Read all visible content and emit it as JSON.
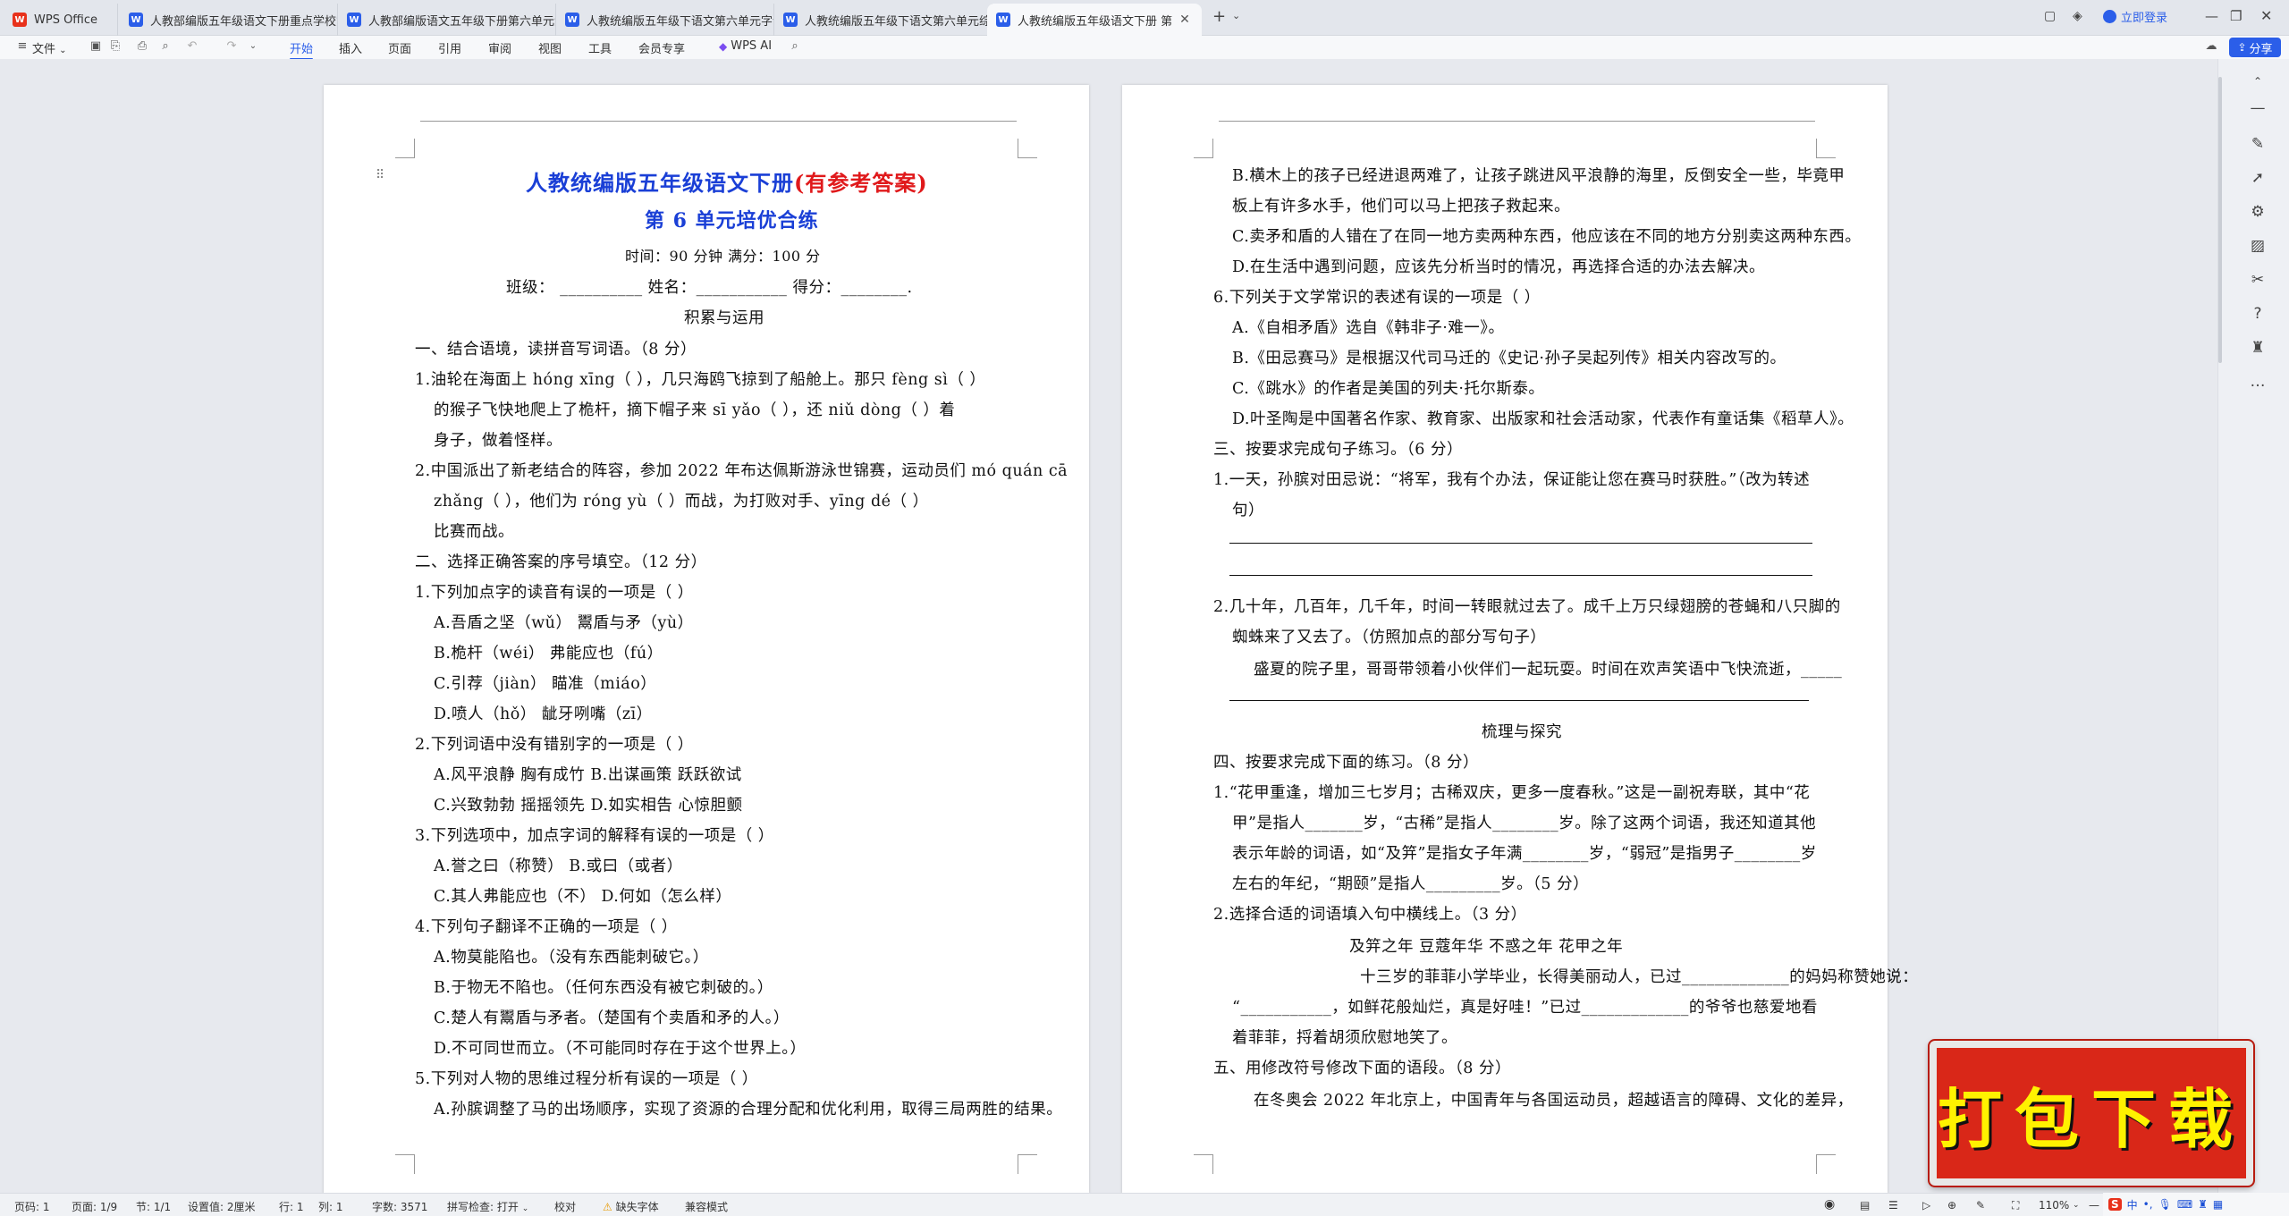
{
  "app": {
    "name": "WPS Office",
    "login": "立即登录"
  },
  "tabs": [
    {
      "label": "人教部编版五年级语文下册重点学校第"
    },
    {
      "label": "人教部编版语文五年级下册第六单元测"
    },
    {
      "label": "人教统编版五年级下语文第六单元字词"
    },
    {
      "label": "人教统编版五年级下语文第六单元综合"
    },
    {
      "label": "人教统编版五年级语文下册 第"
    }
  ],
  "menu": {
    "file": "文件",
    "items": [
      "开始",
      "插入",
      "页面",
      "引用",
      "审阅",
      "视图",
      "工具",
      "会员专享"
    ],
    "ai": "WPS AI",
    "share": "分享"
  },
  "page1": {
    "title_blue": "人教统编版五年级语文下册",
    "title_red": "(有参考答案)",
    "subtitle": "第 6 单元培优合练",
    "time": "时间：90 分钟  满分：100 分",
    "student": "班级：  __________  姓名：___________  得分：________.",
    "section_head": "积累与运用",
    "lines": [
      "一、结合语境，读拼音写词语。（8 分）",
      "1.油轮在海面上 hóng xīng（      ），几只海鸥飞掠到了船舱上。那只 fèng sì（      ）",
      "的猴子飞快地爬上了桅杆，摘下帽子来 sī yǎo（      ），还 niǔ dòng（      ）着",
      "身子，做着怪样。",
      "2.中国派出了新老结合的阵容，参加 2022 年布达佩斯游泳世锦赛，运动员们 mó quán cā",
      "zhǎng（        ），他们为 róng yù（       ）而战，为打败对手、yīng dé（      ）",
      "比赛而战。",
      "二、选择正确答案的序号填空。（12 分）",
      "1.下列加点字的读音有误的一项是（    ）",
      "A.吾盾之坚（wǔ）             鬻盾与矛（yù）",
      "B.桅杆（wéi）                弗能应也（fú）",
      "C.引荐（jiàn）               瞄准（miáo）",
      "D.喷人（hǒ）                 龇牙咧嘴（zī）",
      "2.下列词语中没有错别字的一项是（    ）",
      "A.风平浪静      胸有成竹       B.出谋画策       跃跃欲试",
      "C.兴致勃勃      摇摇领先       D.如实相告       心惊胆颤",
      "3.下列选项中，加点字词的解释有误的一项是（    ）",
      "A.誉之曰（称赞）                B.或曰（或者）",
      "C.其人弗能应也（不）            D.何如（怎么样）",
      "4.下列句子翻译不正确的一项是（    ）",
      "A.物莫能陷也。（没有东西能刺破它。）",
      "B.于物无不陷也。（任何东西没有被它刺破的。）",
      "C.楚人有鬻盾与矛者。（楚国有个卖盾和矛的人。）",
      "D.不可同世而立。（不可能同时存在于这个世界上。）",
      "5.下列对人物的思维过程分析有误的一项是（    ）",
      "A.孙膑调整了马的出场顺序，实现了资源的合理分配和优化利用，取得三局两胜的结果。"
    ]
  },
  "page2": {
    "lines": [
      "B.横木上的孩子已经进退两难了，让孩子跳进风平浪静的海里，反倒安全一些，毕竟甲",
      "板上有许多水手，他们可以马上把孩子救起来。",
      "C.卖矛和盾的人错在了在同一地方卖两种东西，他应该在不同的地方分别卖这两种东西。",
      "D.在生活中遇到问题，应该先分析当时的情况，再选择合适的办法去解决。",
      "6.下列关于文学常识的表述有误的一项是（    ）",
      "A.《自相矛盾》选自《韩非子·难一》。",
      "B.《田忌赛马》是根据汉代司马迁的《史记·孙子吴起列传》相关内容改写的。",
      "C.《跳水》的作者是美国的列夫·托尔斯泰。",
      "D.叶圣陶是中国著名作家、教育家、出版家和社会活动家，代表作有童话集《稻草人》。",
      "三、按要求完成句子练习。（6 分）",
      "1.一天，孙膑对田忌说：“将军，我有个办法，保证能让您在赛马时获胜。”（改为转述",
      "句）",
      "2.几十年，几百年，几千年，时间一转眼就过去了。成千上万只绿翅膀的苍蝇和八只脚的",
      "蜘蛛来了又去了。（仿照加点的部分写句子）",
      "盛夏的院子里，哥哥带领着小伙伴们一起玩耍。时间在欢声笑语中飞快流逝，_____",
      "梳理与探究",
      "四、按要求完成下面的练习。（8 分）",
      "1.“花甲重逢，增加三七岁月；古稀双庆，更多一度春秋。”这是一副祝寿联，其中“花",
      "甲”是指人_______岁，“古稀”是指人________岁。除了这两个词语，我还知道其他",
      "表示年龄的词语，如“及笄”是指女子年满________岁，“弱冠”是指男子________岁",
      "左右的年纪，“期颐”是指人_________岁。（5 分）",
      "2.选择合适的词语填入句中横线上。（3 分）",
      "及笄之年        豆蔻年华        不惑之年        花甲之年",
      "十三岁的菲菲小学毕业，长得美丽动人，已过_____________的妈妈称赞她说：",
      "“___________，如鲜花般灿烂，真是好哇！”已过_____________的爷爷也慈爱地看",
      "着菲菲，捋着胡须欣慰地笑了。",
      "五、用修改符号修改下面的语段。（8 分）",
      "在冬奥会 2022 年北京上，中国青年与各国运动员，超越语言的障碍、文化的差异，"
    ]
  },
  "status": {
    "page": "页码: 1",
    "pages": "页面: 1/9",
    "section": "节: 1/1",
    "setting": "设置值: 2厘米",
    "row": "行: 1",
    "col": "列: 1",
    "words": "字数: 3571",
    "spell": "拼写检查: 打开",
    "proof": "校对",
    "missing_font": "缺失字体",
    "compat": "兼容模式",
    "zoom": "110%"
  },
  "promo": {
    "label": "打包下载"
  },
  "colors": {
    "accent": "#2b5ee9",
    "title_blue": "#1a3fd6",
    "title_red": "#e0191b",
    "promo": "#d92718"
  }
}
